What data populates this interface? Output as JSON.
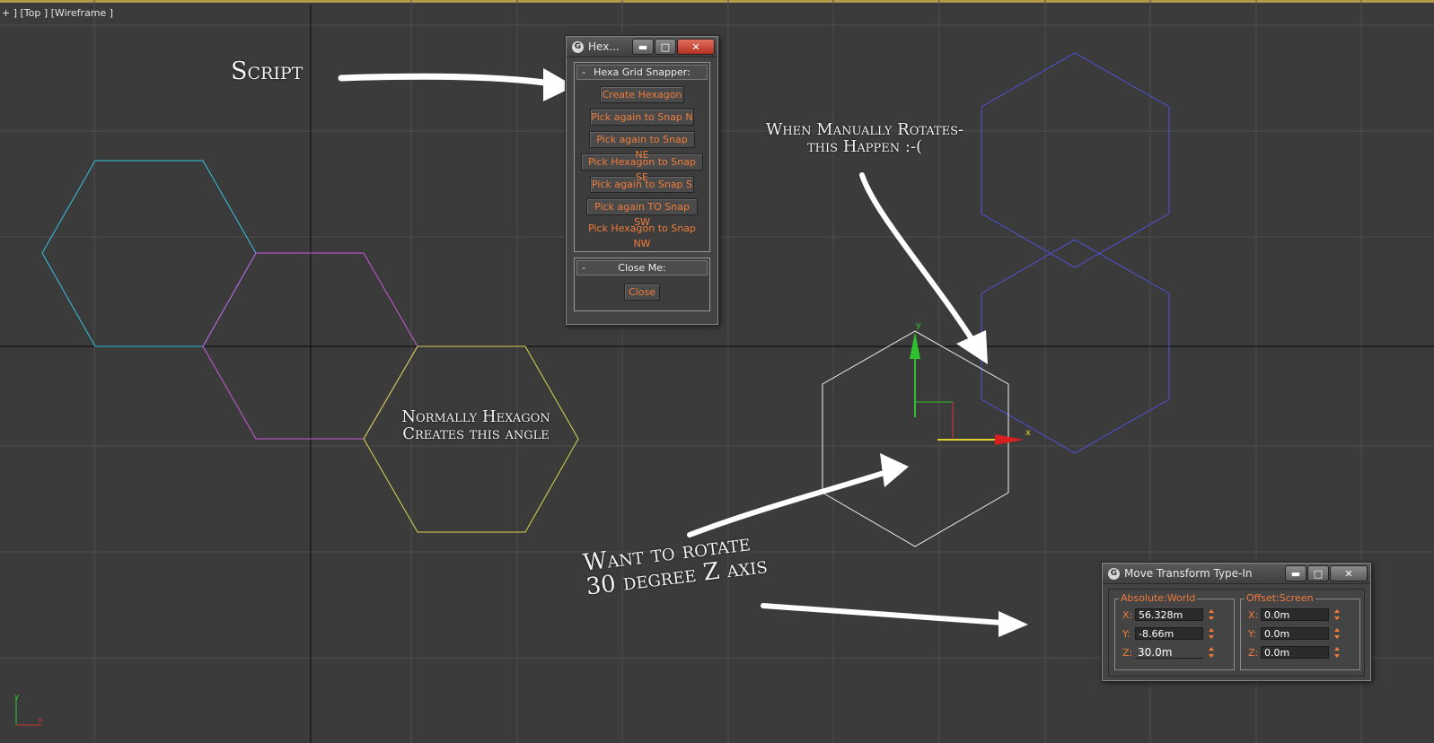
{
  "viewport": {
    "label": "+ ] [Top ] [Wireframe ]",
    "background": "#3b3b3b",
    "grid_color": "#4e4e4e",
    "axis_color": "#0f0f0f"
  },
  "annotations": {
    "script": "Script",
    "rotate_line1": "When Manually Rotates-",
    "rotate_line2": "this Happen  :-(",
    "normal_line1": "Normally Hexagon",
    "normal_line2": "Creates this angle",
    "want_line1": "Want to rotate",
    "want_line2": "30 degree Z axis"
  },
  "gizmo": {
    "x_label": "x",
    "y_label": "y"
  },
  "corner_axis": {
    "x_label": "x",
    "y_label": "y"
  },
  "hexagons": {
    "cyan": "#33c4e0",
    "magenta": "#c85ad8",
    "yellow": "#d8d850",
    "blue": "#5252d8",
    "white": "#f0f0f0"
  },
  "script_window": {
    "title": "Hex...",
    "minimize": "▬",
    "maximize": "□",
    "close": "✕",
    "rollout1": {
      "title": "Hexa Grid Snapper:",
      "collapse": "-",
      "buttons": [
        "Create Hexagon",
        "Pick again to Snap N",
        "Pick again to Snap NE",
        "Pick Hexagon to Snap SE",
        "Pick again to Snap S",
        "Pick again TO Snap SW",
        "Pick Hexagon to Snap NW"
      ]
    },
    "rollout2": {
      "title": "Close Me:",
      "collapse": "-",
      "button": "Close"
    },
    "accent": "#f07c3a"
  },
  "transform_window": {
    "title": "Move Transform Type-In",
    "minimize": "▬",
    "maximize": "□",
    "close": "✕",
    "absolute": {
      "label": "Absolute:World",
      "x_label": "X:",
      "x_value": "56.328m",
      "y_label": "Y:",
      "y_value": "-8.66m",
      "z_label": "Z:",
      "z_value": "30.0m"
    },
    "offset": {
      "label": "Offset:Screen",
      "x_label": "X:",
      "x_value": "0.0m",
      "y_label": "Y:",
      "y_value": "0.0m",
      "z_label": "Z:",
      "z_value": "0.0m"
    }
  }
}
